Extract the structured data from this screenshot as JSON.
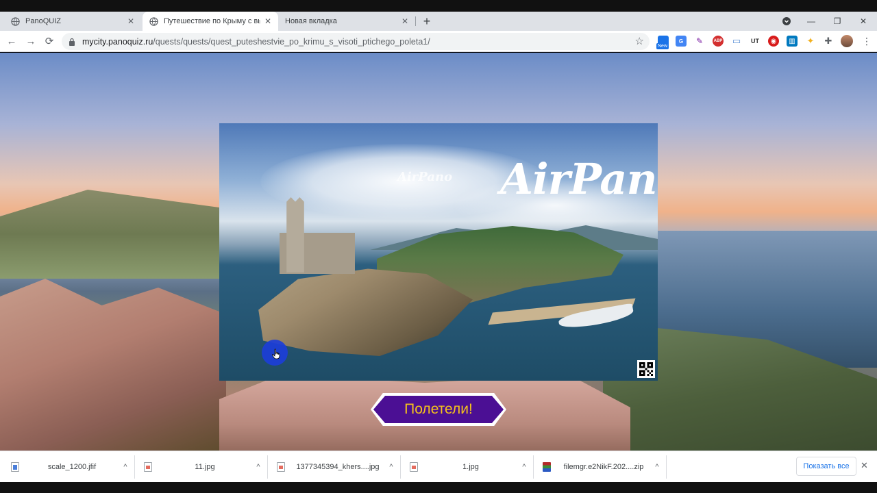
{
  "browser": {
    "tabs": [
      {
        "title": "PanoQUIZ",
        "close": "✕"
      },
      {
        "title": "Путешествие по Крыму с высот",
        "close": "✕"
      },
      {
        "title": "Новая вкладка",
        "close": "✕"
      }
    ],
    "new_tab": "+",
    "window_buttons": {
      "menu": "⌄",
      "minimize": "—",
      "maximize": "❐",
      "close": "✕"
    },
    "nav": {
      "back": "←",
      "forward": "→",
      "reload": "⟳"
    },
    "url_host": "mycity.panoquiz.ru",
    "url_path": "/quests/quests/quest_puteshestvie_po_krimu_s_visoti_ptichego_poleta1/",
    "bookmark_star": "☆",
    "extensions": [
      {
        "label": "",
        "color": "#1a73e8"
      },
      {
        "label": "G",
        "color": "#4285f4"
      },
      {
        "label": "✎",
        "color": "#7b1fa2"
      },
      {
        "label": "ABP",
        "color": "#d32f2f"
      },
      {
        "label": "▭",
        "color": "#5a8fd6"
      },
      {
        "label": "UT",
        "color": "#333333"
      },
      {
        "label": "◉",
        "color": "#d81b1b"
      },
      {
        "label": "▥",
        "color": "#0079bf"
      },
      {
        "label": "✦",
        "color": "#f2b01e"
      },
      {
        "label": "✚",
        "color": "#5f6368"
      }
    ],
    "new_badge": "New"
  },
  "page": {
    "preview_logo": "AirPano",
    "preview_logo_watermark": "AirPano",
    "cta_label": "Полетели!"
  },
  "downloads": {
    "items": [
      {
        "name": "scale_1200.jfif",
        "type": "doc"
      },
      {
        "name": "11.jpg",
        "type": "img"
      },
      {
        "name": "1377345394_khers....jpg",
        "type": "img"
      },
      {
        "name": "1.jpg",
        "type": "img"
      },
      {
        "name": "filemgr.e2NikF.202....zip",
        "type": "zip"
      }
    ],
    "chevron": "^",
    "show_all": "Показать все",
    "close": "✕"
  }
}
